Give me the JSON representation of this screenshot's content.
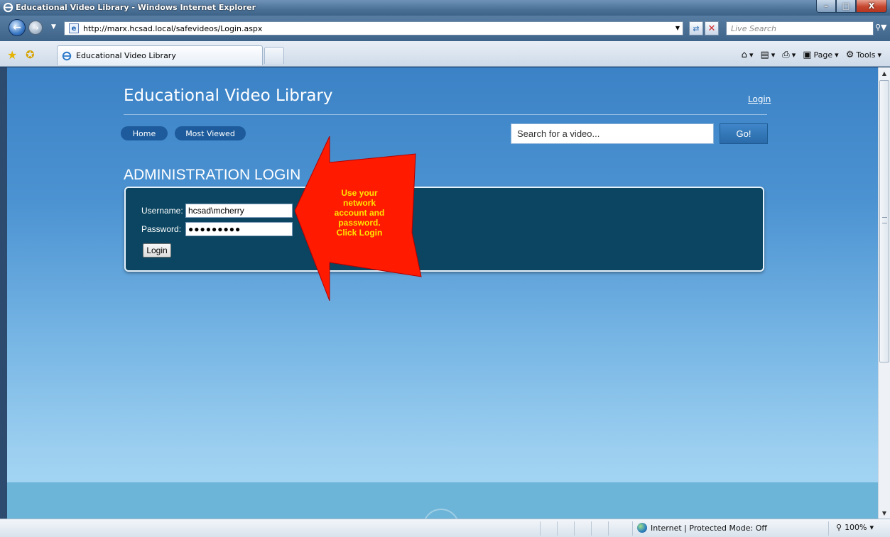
{
  "window": {
    "title": "Educational Video Library - Windows Internet Explorer",
    "buttons": {
      "minimize": "–",
      "maximize": "□",
      "close": "X"
    }
  },
  "address_bar": {
    "url": "http://marx.hcsad.local/safevideos/Login.aspx",
    "live_search_placeholder": "Live Search"
  },
  "tab": {
    "label": "Educational Video Library"
  },
  "commands": {
    "page": "Page",
    "tools": "Tools"
  },
  "site": {
    "title": "Educational Video Library",
    "login_link": "Login",
    "nav": [
      {
        "label": "Home"
      },
      {
        "label": "Most Viewed"
      }
    ],
    "search_placeholder": "Search for a video...",
    "go_label": "Go!"
  },
  "login_form": {
    "heading": "ADMINISTRATION LOGIN",
    "username_label": "Username:",
    "username_value": "hcsad\\mcherry",
    "password_label": "Password:",
    "password_value": "●●●●●●●●●",
    "login_button": "Login"
  },
  "annotation": {
    "lines": [
      "Use your",
      "network",
      "account and",
      "password.",
      "Click Login"
    ],
    "arrow_color": "#ff0000",
    "text_color": "#ffe500"
  },
  "status_bar": {
    "zone": "Internet | Protected Mode: Off",
    "zoom": "100%"
  },
  "colors": {
    "panel": "#0b4561",
    "accent": "#1d5b9c"
  }
}
